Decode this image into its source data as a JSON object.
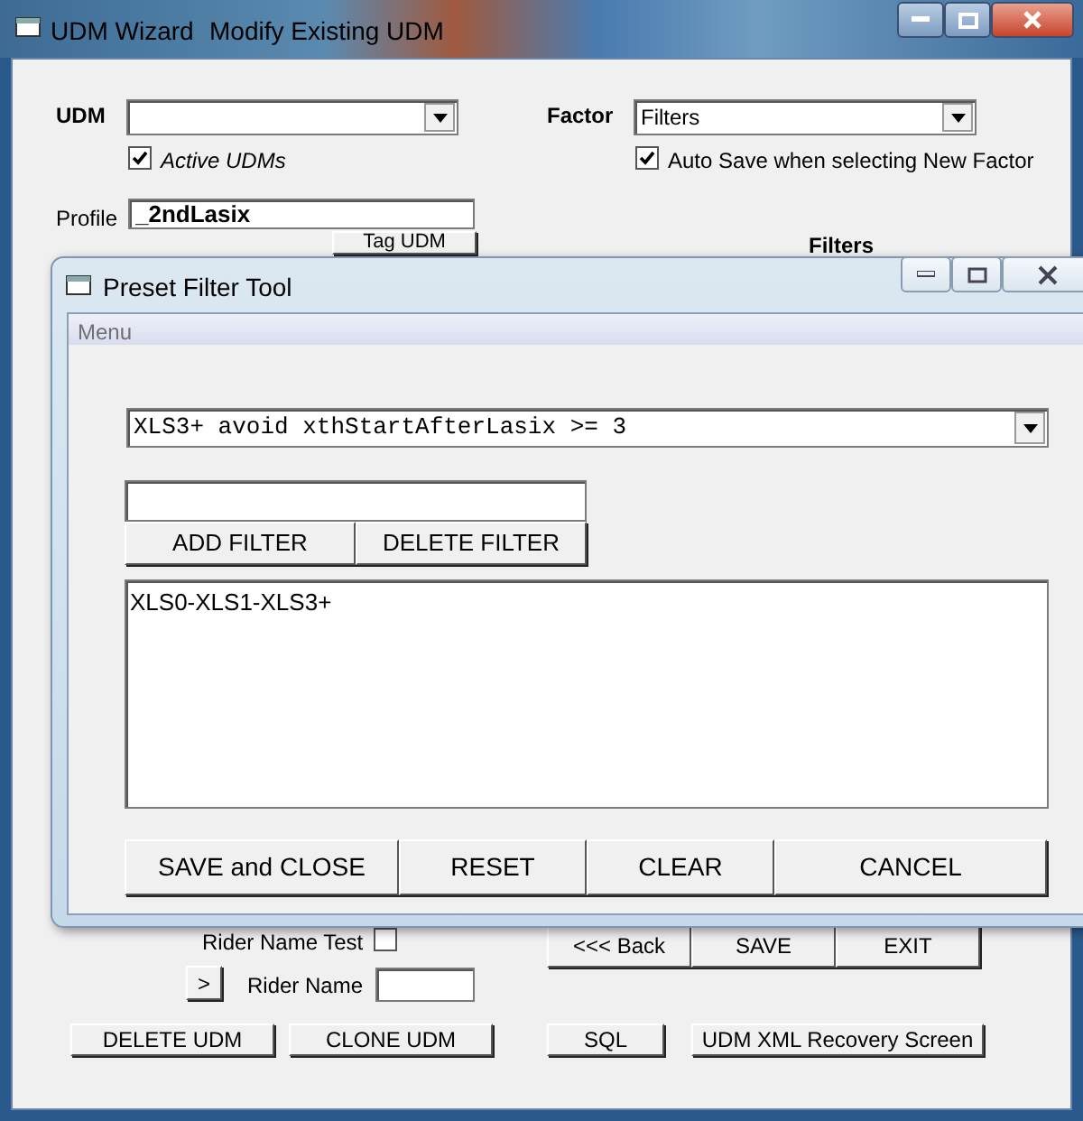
{
  "window": {
    "title": "UDM Wizard",
    "subtitle": "Modify Existing UDM"
  },
  "udm": {
    "label": "UDM",
    "checkbox": {
      "label": "Active UDMs",
      "checked": true
    }
  },
  "factor": {
    "label": "Factor",
    "value": "Filters",
    "checkbox": {
      "label": "Auto Save when selecting New Factor",
      "checked": true
    }
  },
  "profile": {
    "label": "Profile",
    "value": "_2ndLasix"
  },
  "tag_button": "Tag UDM",
  "filters_label": "Filters",
  "dialog": {
    "title": "Preset Filter Tool",
    "menu": "Menu",
    "preset": "XLS3+ avoid xthStartAfterLasix >= 3",
    "filter_buttons": [
      "ADD FILTER",
      "DELETE FILTER"
    ],
    "list_items": [
      "XLS0-XLS1-XLS3+"
    ],
    "footer_buttons": [
      "SAVE and CLOSE",
      "RESET",
      "CLEAR",
      "CANCEL"
    ]
  },
  "rider_name_test": {
    "label": "Rider Name Test",
    "checked": false
  },
  "expand_button": ">",
  "rider_name": {
    "label": "Rider Name"
  },
  "nav_buttons": [
    "<<< Back",
    "SAVE",
    "EXIT"
  ],
  "bottom_buttons": [
    "DELETE UDM",
    "CLONE UDM",
    "SQL",
    "UDM XML Recovery Screen"
  ]
}
